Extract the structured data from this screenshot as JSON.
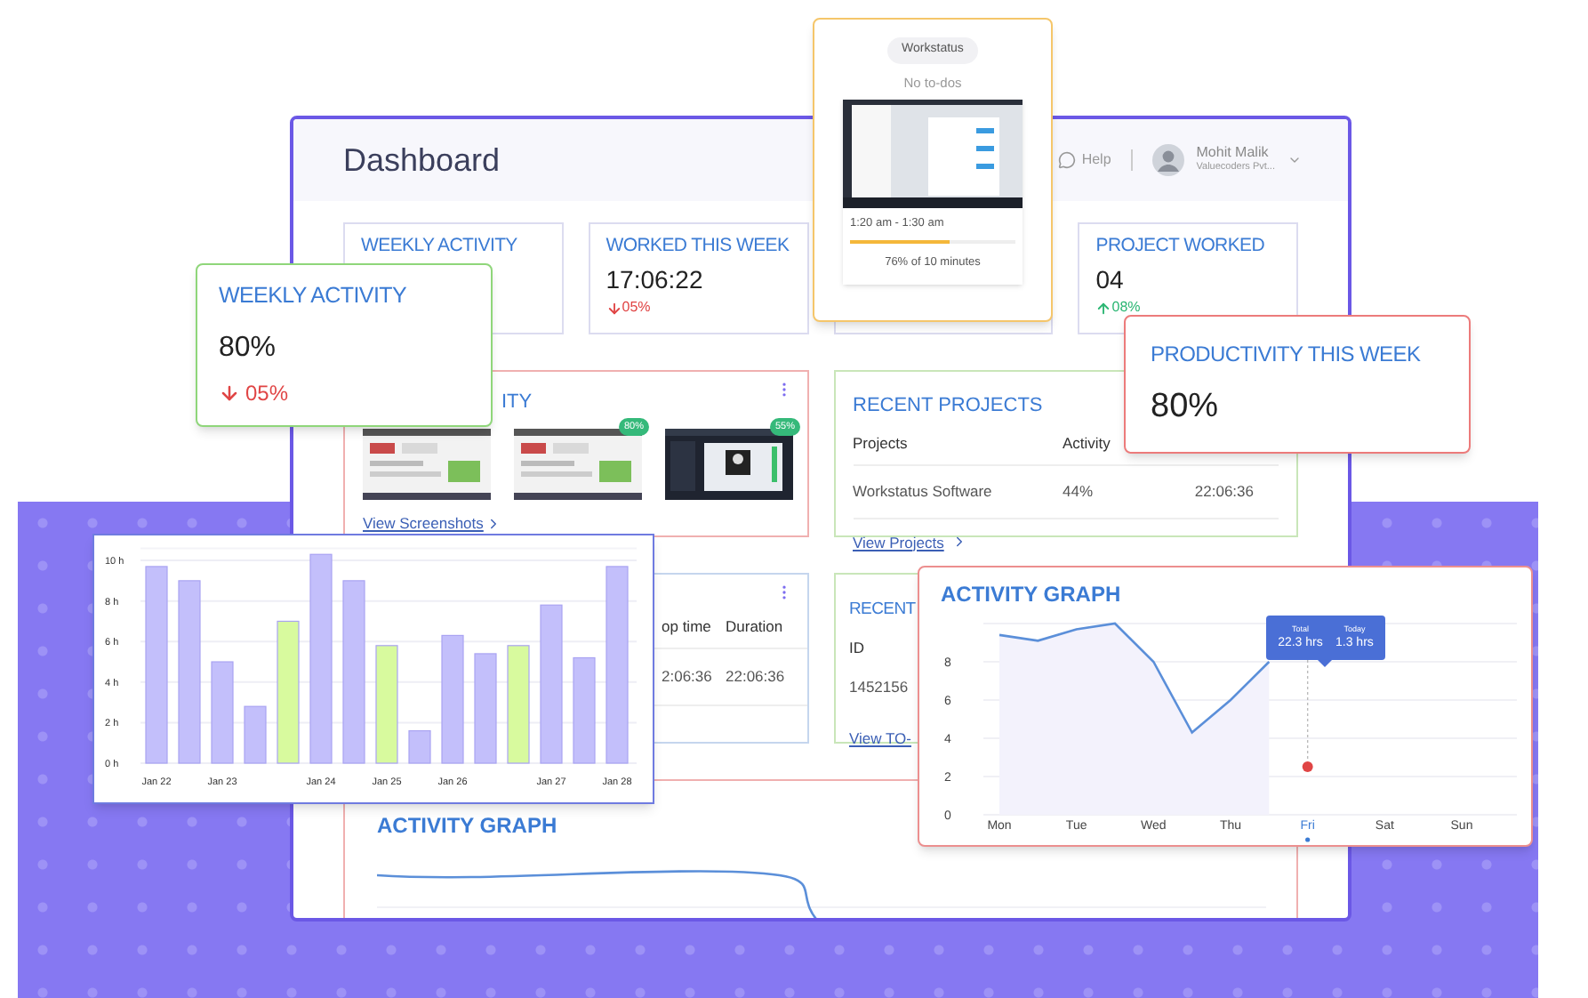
{
  "dashboard": {
    "title": "Dashboard",
    "help": "Help",
    "user": {
      "name": "Mohit Malik",
      "company": "Valuecoders Pvt..."
    },
    "stats": [
      {
        "kind": "stat",
        "title": "WEEKLY ACTIVITY"
      },
      {
        "kind": "stat",
        "title": "WORKED THIS WEEK",
        "value": "17:06:22",
        "change": "05%",
        "rising": false
      },
      {
        "kind": "covered"
      },
      {
        "kind": "stat",
        "title": "PROJECT WORKED",
        "value": "04",
        "change": "08%",
        "rising": true
      }
    ],
    "screenshots": {
      "title": "ITY",
      "thumbnails": [
        {
          "dark": false
        },
        {
          "dark": false,
          "badge": "80%"
        },
        {
          "dark": true,
          "badge": "55%"
        }
      ],
      "link": "View Screenshots"
    },
    "recent_projects": {
      "title": "RECENT PROJECTS",
      "columns": [
        "Projects",
        "Activity"
      ],
      "rows": [
        [
          "Workstatus Software",
          "44%",
          "22:06:36"
        ]
      ],
      "link": "View Projects"
    },
    "timesheet": {
      "columns": [
        "op time",
        "Duration"
      ],
      "rows": [
        [
          "2:06:36",
          "22:06:36"
        ]
      ]
    },
    "recent_todos": {
      "title": "RECENT",
      "columns": [
        "ID"
      ],
      "rows": [
        [
          "1452156"
        ]
      ],
      "link": "View TO-"
    },
    "activity_graph": {
      "title": "ACTIVITY GRAPH"
    }
  },
  "workstatus_card": {
    "app": "Workstatus",
    "todo": "No to-dos",
    "time": "1:20 am - 1:30 am",
    "level": 0.6,
    "caption": "76% of 10 minutes"
  },
  "weekly_card": {
    "title": "WEEKLY ACTIVITY",
    "value": "80%",
    "change": "05%",
    "rising": false
  },
  "productivity_card": {
    "title": "PRODUCTIVITY THIS WEEK",
    "value": "80%"
  },
  "bar_chart_card": {
    "chart_data": {
      "type": "bar",
      "grid": true,
      "categories": [
        "Jan 22",
        null,
        "Jan 23",
        null,
        null,
        "Jan 24",
        null,
        "Jan 25",
        null,
        "Jan 26",
        null,
        null,
        "Jan 27",
        null,
        "Jan 28"
      ],
      "series": [
        {
          "color": "#c3bffb",
          "values": [
            9.7,
            9,
            5,
            2.8,
            null,
            10.3,
            9,
            null,
            1.6,
            6.3,
            5.4,
            null,
            7.8,
            5.2,
            9.7
          ]
        },
        {
          "color": "#d8fa9e",
          "values": [
            null,
            null,
            null,
            null,
            7,
            null,
            null,
            5.8,
            null,
            null,
            null,
            5.8,
            null,
            null,
            null
          ]
        }
      ],
      "ylim": [
        0,
        10.6
      ],
      "yticks": [
        {
          "value": 0,
          "label": "0 h"
        },
        {
          "value": 2,
          "label": "2 h"
        },
        {
          "value": 4,
          "label": "4 h"
        },
        {
          "value": 6,
          "label": "6 h"
        },
        {
          "value": 8,
          "label": "8 h"
        },
        {
          "value": 10,
          "label": "10 h"
        }
      ]
    }
  },
  "activity_card": {
    "title": "ACTIVITY GRAPH",
    "chart_data": {
      "type": "area",
      "grid": true,
      "categories": [
        "Mon",
        null,
        "Tue",
        null,
        "Wed",
        null,
        "Thu",
        null,
        "Fri",
        null,
        "Sat",
        null,
        "Sun"
      ],
      "series": [
        {
          "color": "#5b8fd9",
          "values": [
            9.4,
            9.1,
            9.7,
            10,
            8,
            4.3,
            6,
            8,
            null,
            null,
            null,
            null,
            null
          ]
        }
      ],
      "ylim": [
        0,
        10
      ],
      "yticks": [
        {
          "value": 0,
          "label": "0"
        },
        {
          "value": 2,
          "label": "2"
        },
        {
          "value": 4,
          "label": "4"
        },
        {
          "value": 6,
          "label": "6"
        },
        {
          "value": 8,
          "label": "8"
        }
      ]
    },
    "day_states": [
      {
        "selected": false
      },
      {
        "selected": false
      },
      {
        "selected": false
      },
      {
        "selected": false
      },
      {
        "selected": true
      },
      {
        "selected": false
      },
      {
        "selected": false
      }
    ],
    "tooltip": [
      {
        "label": "Total",
        "value": "22.3 hrs"
      },
      {
        "label": "Today",
        "value": "1.3 hrs"
      }
    ]
  }
}
